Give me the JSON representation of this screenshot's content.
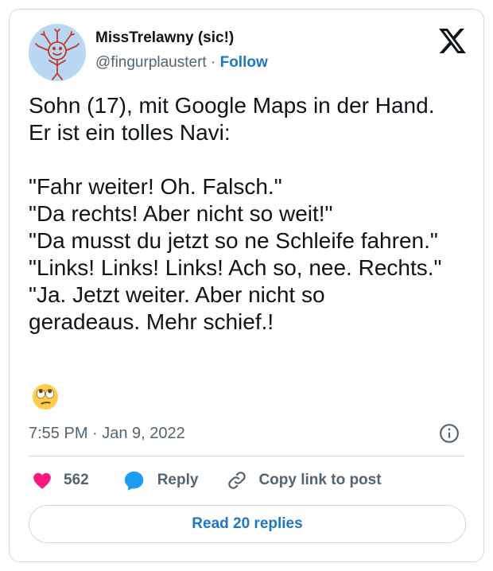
{
  "author": {
    "display_name": "MissTrelawny (sic!)",
    "handle": "@fingurplaustert",
    "separator": "·",
    "follow_label": "Follow",
    "avatar_icon": "hand-drawn-sun-face-avatar"
  },
  "brand_icon": "x-logo-icon",
  "tweet": {
    "text": "Sohn (17), mit Google Maps in der Hand.\nEr ist ein tolles Navi:\n\n\"Fahr weiter! Oh. Falsch.\"\n\"Da rechts! Aber nicht so weit!\"\n\"Da musst du jetzt so ne Schleife fahren.\"\n\"Links! Links! Links! Ach so, nee. Rechts.\"\n\"Ja. Jetzt weiter. Aber nicht so\ngeradeaus. Mehr schief.!",
    "emoji": "face-with-rolling-eyes"
  },
  "meta": {
    "timestamp": "7:55 PM · Jan 9, 2022",
    "info_icon": "info-icon"
  },
  "actions": {
    "like_count": "562",
    "reply_label": "Reply",
    "copy_link_label": "Copy link to post"
  },
  "read_replies_label": "Read 20 replies",
  "colors": {
    "accent": "#1d77c9",
    "like": "#f91880",
    "reply_icon": "#1d9bf0",
    "text_primary": "#0f1419",
    "text_secondary": "#536471",
    "border": "#cfd9de"
  }
}
